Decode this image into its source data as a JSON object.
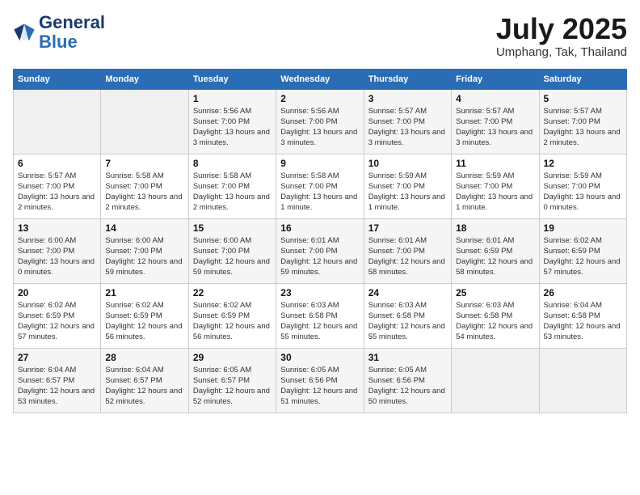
{
  "header": {
    "logo_line1": "General",
    "logo_line2": "Blue",
    "month_year": "July 2025",
    "location": "Umphang, Tak, Thailand"
  },
  "weekdays": [
    "Sunday",
    "Monday",
    "Tuesday",
    "Wednesday",
    "Thursday",
    "Friday",
    "Saturday"
  ],
  "weeks": [
    [
      {
        "day": "",
        "info": ""
      },
      {
        "day": "",
        "info": ""
      },
      {
        "day": "1",
        "info": "Sunrise: 5:56 AM\nSunset: 7:00 PM\nDaylight: 13 hours and 3 minutes."
      },
      {
        "day": "2",
        "info": "Sunrise: 5:56 AM\nSunset: 7:00 PM\nDaylight: 13 hours and 3 minutes."
      },
      {
        "day": "3",
        "info": "Sunrise: 5:57 AM\nSunset: 7:00 PM\nDaylight: 13 hours and 3 minutes."
      },
      {
        "day": "4",
        "info": "Sunrise: 5:57 AM\nSunset: 7:00 PM\nDaylight: 13 hours and 3 minutes."
      },
      {
        "day": "5",
        "info": "Sunrise: 5:57 AM\nSunset: 7:00 PM\nDaylight: 13 hours and 2 minutes."
      }
    ],
    [
      {
        "day": "6",
        "info": "Sunrise: 5:57 AM\nSunset: 7:00 PM\nDaylight: 13 hours and 2 minutes."
      },
      {
        "day": "7",
        "info": "Sunrise: 5:58 AM\nSunset: 7:00 PM\nDaylight: 13 hours and 2 minutes."
      },
      {
        "day": "8",
        "info": "Sunrise: 5:58 AM\nSunset: 7:00 PM\nDaylight: 13 hours and 2 minutes."
      },
      {
        "day": "9",
        "info": "Sunrise: 5:58 AM\nSunset: 7:00 PM\nDaylight: 13 hours and 1 minute."
      },
      {
        "day": "10",
        "info": "Sunrise: 5:59 AM\nSunset: 7:00 PM\nDaylight: 13 hours and 1 minute."
      },
      {
        "day": "11",
        "info": "Sunrise: 5:59 AM\nSunset: 7:00 PM\nDaylight: 13 hours and 1 minute."
      },
      {
        "day": "12",
        "info": "Sunrise: 5:59 AM\nSunset: 7:00 PM\nDaylight: 13 hours and 0 minutes."
      }
    ],
    [
      {
        "day": "13",
        "info": "Sunrise: 6:00 AM\nSunset: 7:00 PM\nDaylight: 13 hours and 0 minutes."
      },
      {
        "day": "14",
        "info": "Sunrise: 6:00 AM\nSunset: 7:00 PM\nDaylight: 12 hours and 59 minutes."
      },
      {
        "day": "15",
        "info": "Sunrise: 6:00 AM\nSunset: 7:00 PM\nDaylight: 12 hours and 59 minutes."
      },
      {
        "day": "16",
        "info": "Sunrise: 6:01 AM\nSunset: 7:00 PM\nDaylight: 12 hours and 59 minutes."
      },
      {
        "day": "17",
        "info": "Sunrise: 6:01 AM\nSunset: 7:00 PM\nDaylight: 12 hours and 58 minutes."
      },
      {
        "day": "18",
        "info": "Sunrise: 6:01 AM\nSunset: 6:59 PM\nDaylight: 12 hours and 58 minutes."
      },
      {
        "day": "19",
        "info": "Sunrise: 6:02 AM\nSunset: 6:59 PM\nDaylight: 12 hours and 57 minutes."
      }
    ],
    [
      {
        "day": "20",
        "info": "Sunrise: 6:02 AM\nSunset: 6:59 PM\nDaylight: 12 hours and 57 minutes."
      },
      {
        "day": "21",
        "info": "Sunrise: 6:02 AM\nSunset: 6:59 PM\nDaylight: 12 hours and 56 minutes."
      },
      {
        "day": "22",
        "info": "Sunrise: 6:02 AM\nSunset: 6:59 PM\nDaylight: 12 hours and 56 minutes."
      },
      {
        "day": "23",
        "info": "Sunrise: 6:03 AM\nSunset: 6:58 PM\nDaylight: 12 hours and 55 minutes."
      },
      {
        "day": "24",
        "info": "Sunrise: 6:03 AM\nSunset: 6:58 PM\nDaylight: 12 hours and 55 minutes."
      },
      {
        "day": "25",
        "info": "Sunrise: 6:03 AM\nSunset: 6:58 PM\nDaylight: 12 hours and 54 minutes."
      },
      {
        "day": "26",
        "info": "Sunrise: 6:04 AM\nSunset: 6:58 PM\nDaylight: 12 hours and 53 minutes."
      }
    ],
    [
      {
        "day": "27",
        "info": "Sunrise: 6:04 AM\nSunset: 6:57 PM\nDaylight: 12 hours and 53 minutes."
      },
      {
        "day": "28",
        "info": "Sunrise: 6:04 AM\nSunset: 6:57 PM\nDaylight: 12 hours and 52 minutes."
      },
      {
        "day": "29",
        "info": "Sunrise: 6:05 AM\nSunset: 6:57 PM\nDaylight: 12 hours and 52 minutes."
      },
      {
        "day": "30",
        "info": "Sunrise: 6:05 AM\nSunset: 6:56 PM\nDaylight: 12 hours and 51 minutes."
      },
      {
        "day": "31",
        "info": "Sunrise: 6:05 AM\nSunset: 6:56 PM\nDaylight: 12 hours and 50 minutes."
      },
      {
        "day": "",
        "info": ""
      },
      {
        "day": "",
        "info": ""
      }
    ]
  ]
}
